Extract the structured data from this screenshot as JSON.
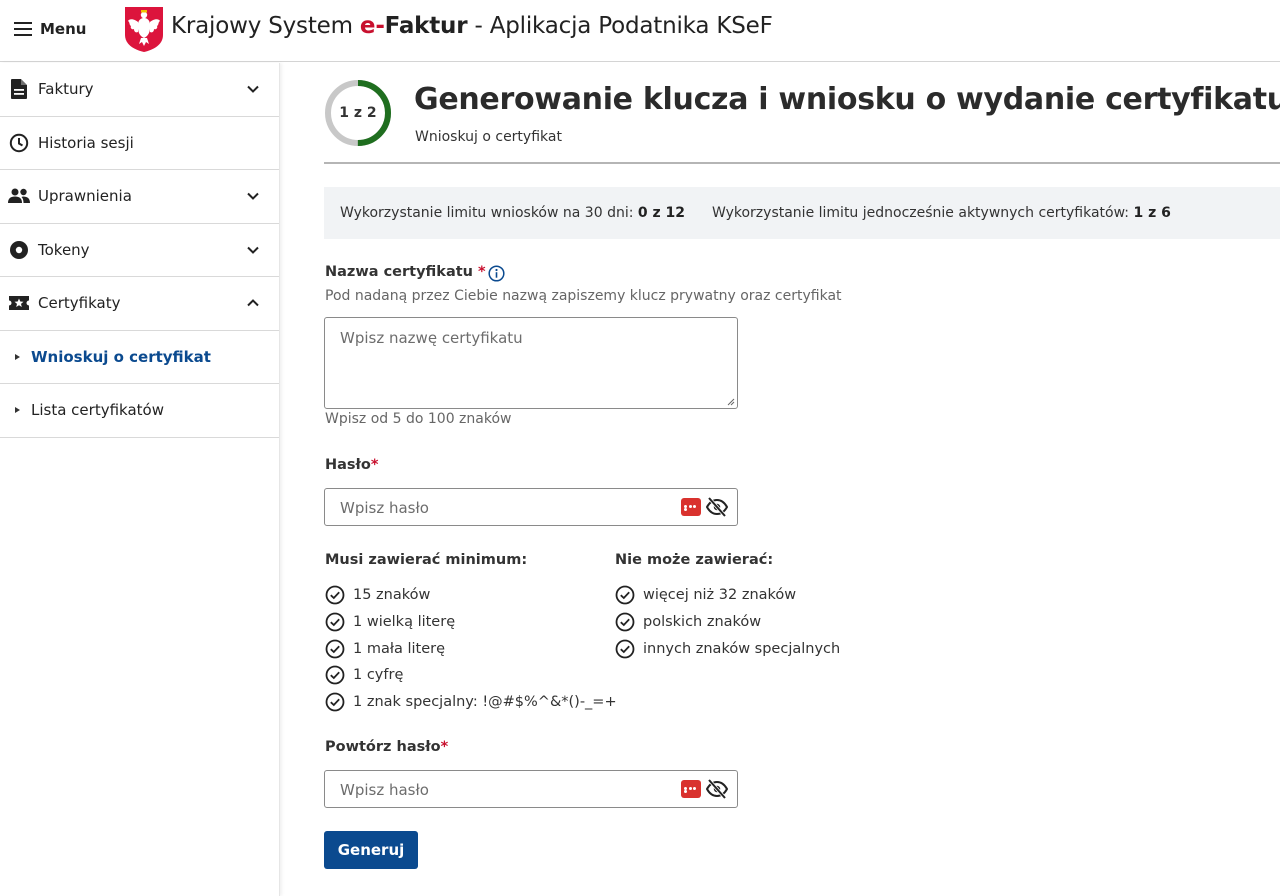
{
  "header": {
    "menu_label": "Menu",
    "title_prefix": "Krajowy System ",
    "title_e": "e-",
    "title_faktur": "Faktur",
    "title_suffix": " - Aplikacja Podatnika KSeF"
  },
  "sidebar": {
    "items": [
      {
        "label": "Faktury",
        "icon": "document-icon",
        "chevron": "down"
      },
      {
        "label": "Historia sesji",
        "icon": "clock-icon",
        "chevron": "none"
      },
      {
        "label": "Uprawnienia",
        "icon": "people-icon",
        "chevron": "down"
      },
      {
        "label": "Tokeny",
        "icon": "token-icon",
        "chevron": "down"
      },
      {
        "label": "Certyfikaty",
        "icon": "certificate-icon",
        "chevron": "up"
      }
    ],
    "subitems": [
      {
        "label": "Wnioskuj o certyfikat",
        "active": true
      },
      {
        "label": "Lista certyfikatów",
        "active": false
      }
    ]
  },
  "main": {
    "step": {
      "text": "1 z 2",
      "current": 1,
      "total": 2
    },
    "title": "Generowanie klucza i wniosku o wydanie certyfikatu",
    "subtitle": "Wnioskuj o certyfikat",
    "limits": {
      "monthly_label": "Wykorzystanie limitu wniosków na 30 dni: ",
      "monthly_value": "0 z 12",
      "active_label": "Wykorzystanie limitu jednocześnie aktywnych certyfikatów: ",
      "active_value": "1 z 6"
    },
    "cert_name": {
      "label": "Nazwa certyfikatu",
      "required_mark": "*",
      "help": "Pod nadaną przez Ciebie nazwą zapiszemy klucz prywatny oraz certyfikat",
      "placeholder": "Wpisz nazwę certyfikatu",
      "hint": "Wpisz od 5 do 100 znaków"
    },
    "password": {
      "label": "Hasło",
      "required_mark": "*",
      "placeholder": "Wpisz hasło"
    },
    "must_contain": {
      "title": "Musi zawierać minimum:",
      "rules": [
        "15 znaków",
        "1 wielką literę",
        "1 mała literę",
        "1 cyfrę",
        "1 znak specjalny: !@#$%^&*()-_=+"
      ]
    },
    "must_not_contain": {
      "title": "Nie może zawierać:",
      "rules": [
        "więcej niż 32 znaków",
        "polskich znaków",
        "innych znaków specjalnych"
      ]
    },
    "repeat_password": {
      "label": "Powtórz hasło",
      "required_mark": "*",
      "placeholder": "Wpisz hasło"
    },
    "submit_label": "Generuj"
  },
  "colors": {
    "accent": "#0b4a8f",
    "required": "#c8102e",
    "progress_ring": "#1f6e1f",
    "ring_track": "#c8c8c8",
    "limits_bg": "#f1f3f5"
  }
}
